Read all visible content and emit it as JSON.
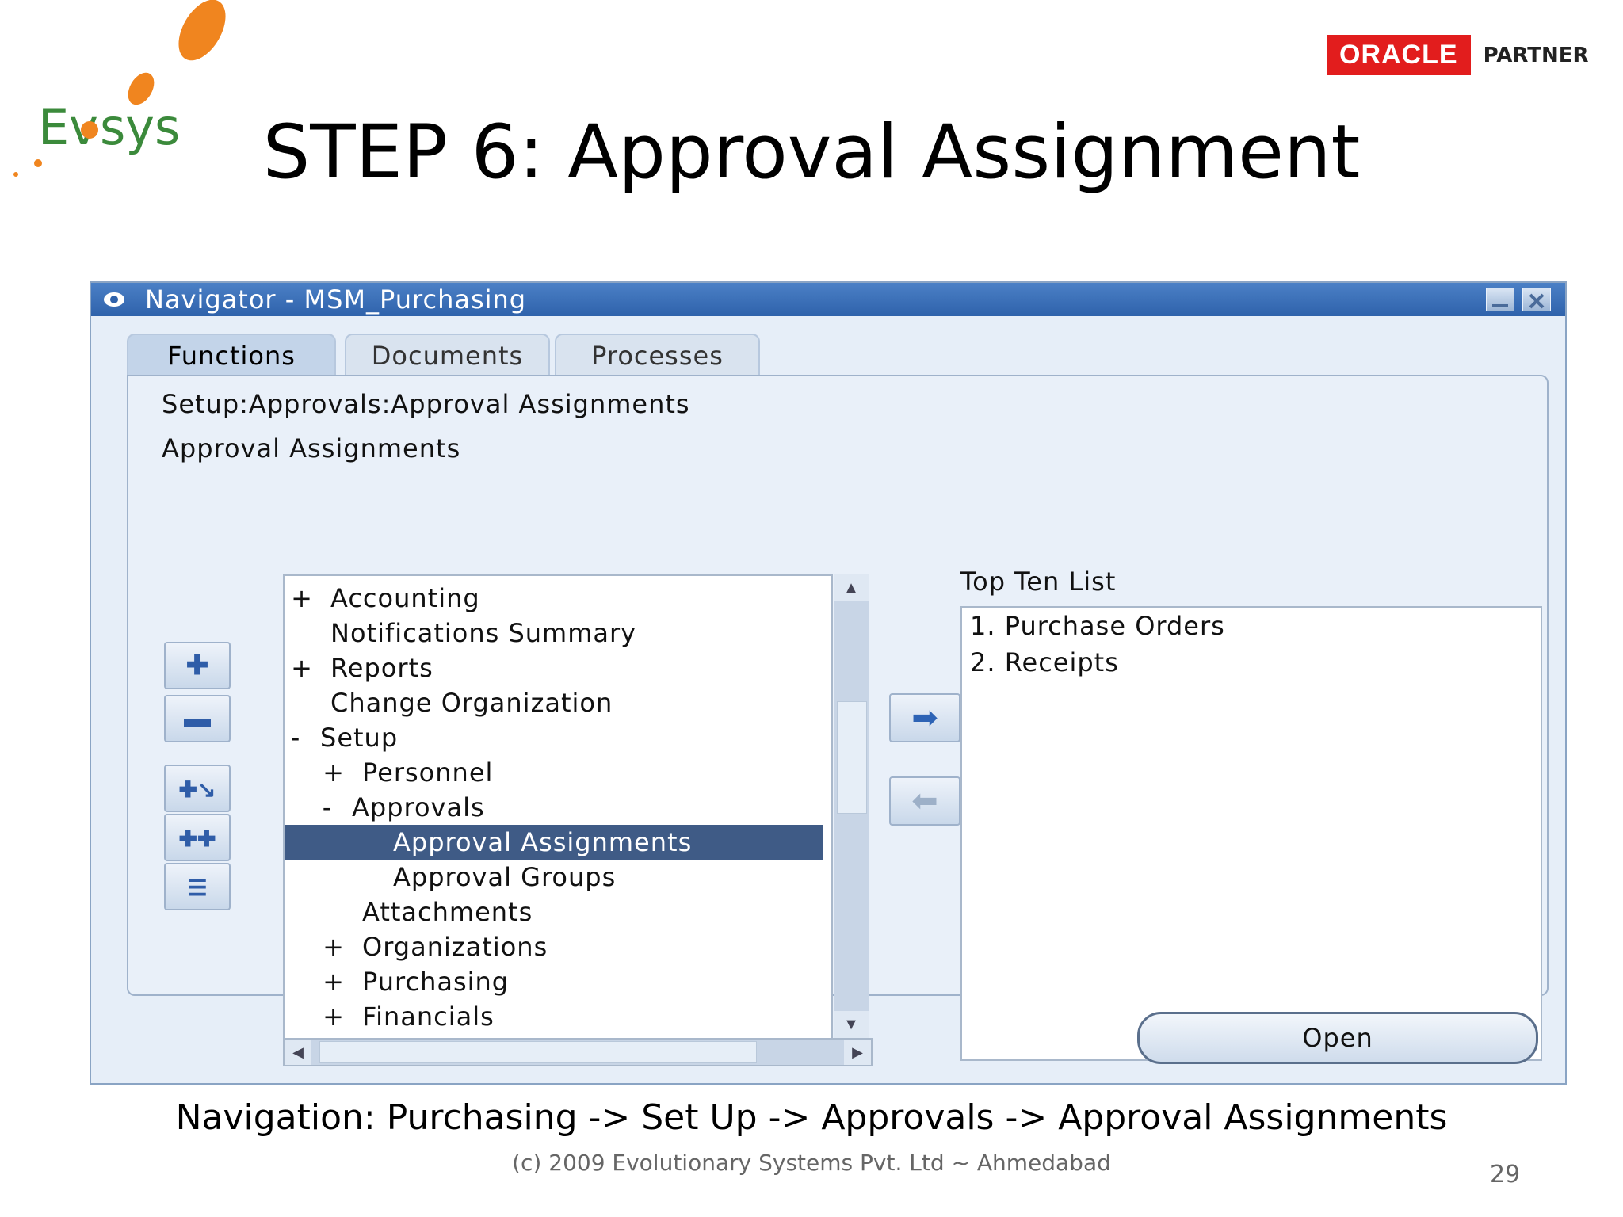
{
  "logo": {
    "text": "Evosys"
  },
  "oracle": {
    "brand": "ORACLE",
    "partner": "PARTNER"
  },
  "slide": {
    "title": "STEP 6: Approval Assignment",
    "navigation": "Navigation: Purchasing -> Set Up -> Approvals -> Approval Assignments",
    "footer": "(c) 2009 Evolutionary Systems Pvt. Ltd ~ Ahmedabad",
    "page_number": "29"
  },
  "window": {
    "title": "Navigator - MSM_Purchasing",
    "tabs": [
      {
        "label": "Functions",
        "active": true
      },
      {
        "label": "Documents",
        "active": false
      },
      {
        "label": "Processes",
        "active": false
      }
    ],
    "path": "Setup:Approvals:Approval Assignments",
    "selected_label": "Approval Assignments",
    "tree": [
      {
        "toggle": "+",
        "label": "Accounting",
        "level": 0
      },
      {
        "toggle": "",
        "label": "Notifications Summary",
        "level": 0
      },
      {
        "toggle": "+",
        "label": "Reports",
        "level": 0
      },
      {
        "toggle": "",
        "label": "Change Organization",
        "level": 0
      },
      {
        "toggle": "-",
        "label": "Setup",
        "level": 0
      },
      {
        "toggle": "+",
        "label": "Personnel",
        "level": 1
      },
      {
        "toggle": "-",
        "label": "Approvals",
        "level": 1
      },
      {
        "toggle": "",
        "label": "Approval Assignments",
        "level": 2,
        "selected": true
      },
      {
        "toggle": "",
        "label": "Approval Groups",
        "level": 2
      },
      {
        "toggle": "",
        "label": "Attachments",
        "level": 1
      },
      {
        "toggle": "+",
        "label": "Organizations",
        "level": 1
      },
      {
        "toggle": "+",
        "label": "Purchasing",
        "level": 1
      },
      {
        "toggle": "+",
        "label": "Financials",
        "level": 1
      }
    ],
    "top_ten_title": "Top Ten List",
    "top_ten": [
      "1. Purchase Orders",
      "2. Receipts"
    ],
    "open_button": "Open"
  },
  "colors": {
    "selection": "#3f5b86",
    "titlebar": "#3a6db5",
    "oracle_red": "#e21d1d"
  }
}
